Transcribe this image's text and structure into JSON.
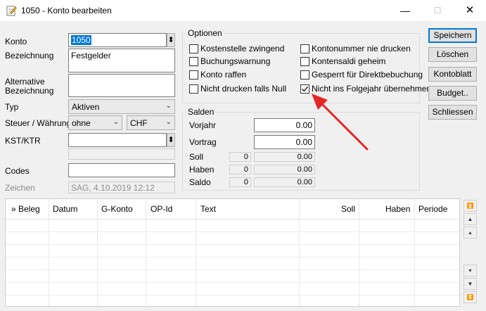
{
  "window": {
    "title": "1050 - Konto bearbeiten",
    "min_glyph": "—",
    "max_glyph": "☐",
    "close_glyph": "✕"
  },
  "form": {
    "konto_label": "Konto",
    "konto_value": "1050",
    "bezeichnung_label": "Bezeichnung",
    "bezeichnung_value": "Festgelder",
    "alt_bezeichnung_label_1": "Alternative",
    "alt_bezeichnung_label_2": "Bezeichnung",
    "alt_bezeichnung_value": "",
    "typ_label": "Typ",
    "typ_value": "Aktiven",
    "steuer_label": "Steuer / Währung",
    "steuer_value": "ohne",
    "waehrung_value": "CHF",
    "kst_label": "KST/KTR",
    "kst_value": "",
    "kst_sub_value": "",
    "codes_label": "Codes",
    "codes_value": "",
    "zeichen_label": "Zeichen",
    "zeichen_value": "SAG,  4.10.2019  12:12",
    "spin_glyph": "⬍",
    "dropdown_glyph": "⌄"
  },
  "optionen": {
    "title": "Optionen",
    "checkboxes": [
      {
        "label": "Kostenstelle zwingend",
        "checked": false
      },
      {
        "label": "Buchungswarnung",
        "checked": false
      },
      {
        "label": "Konto raffen",
        "checked": false
      },
      {
        "label": "Nicht drucken falls Null",
        "checked": false
      },
      {
        "label": "Kontonummer nie drucken",
        "checked": false
      },
      {
        "label": "Kontensaldi geheim",
        "checked": false
      },
      {
        "label": "Gesperrt für Direktbebuchung",
        "checked": false
      },
      {
        "label": "Nicht ins Folgejahr übernehmen",
        "checked": true
      }
    ]
  },
  "salden": {
    "title": "Salden",
    "vorjahr_label": "Vorjahr",
    "vorjahr_value": "0.00",
    "vortrag_label": "Vortrag",
    "vortrag_value": "0.00",
    "soll_label": "Soll",
    "soll_count": "0",
    "soll_value": "0.00",
    "haben_label": "Haben",
    "haben_count": "0",
    "haben_value": "0.00",
    "saldo_label": "Saldo",
    "saldo_count": "0",
    "saldo_value": "0.00"
  },
  "buttons": {
    "speichern": "Speichern",
    "loeschen": "Löschen",
    "kontoblatt": "Kontoblatt",
    "budget": "Budget..",
    "schliessen": "Schliessen"
  },
  "grid": {
    "columns": [
      "» Beleg",
      "Datum",
      "G-Konto",
      "OP-Id",
      "Text",
      "Soll",
      "Haben",
      "Periode"
    ],
    "rows": []
  },
  "nav": {
    "first": "⏫",
    "prev_page": "▲",
    "prev": "▴",
    "next": "▾",
    "next_page": "▼",
    "last": "⏬"
  },
  "colors": {
    "selection": "#0078d7",
    "annotation_arrow": "#e52626"
  }
}
